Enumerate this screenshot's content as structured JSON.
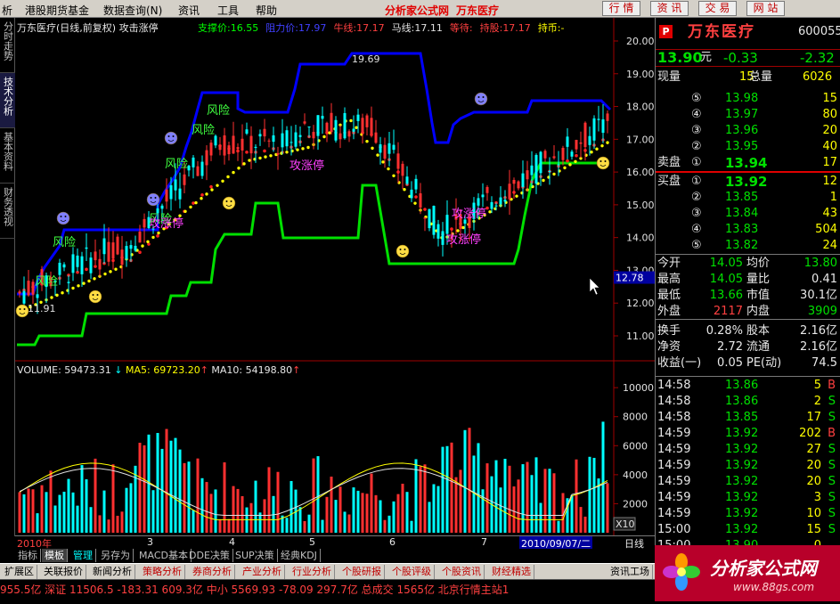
{
  "menu": {
    "items": [
      "析",
      "港股期货基金",
      "数据查询(N)",
      "资讯",
      "工具",
      "帮助"
    ],
    "brand1": "分析家公式网",
    "brand2": "万东医疗",
    "buttons": [
      "行 情",
      "资 讯",
      "交 易",
      "网 站"
    ]
  },
  "left_tabs": [
    "分时走势",
    "技术分析",
    "基本资料",
    "财务透视"
  ],
  "chart": {
    "header_title": "万东医疗(日线,前复权) 攻击涨停",
    "indicators": [
      {
        "label": "支撑价:",
        "value": "16.55",
        "color": "#00ff00"
      },
      {
        "label": "阻力价:",
        "value": "17.97",
        "color": "#4040ff"
      },
      {
        "label": "牛线:",
        "value": "17.17",
        "color": "#ff4040"
      },
      {
        "label": "马线:",
        "value": "17.11",
        "color": "#e0e0e0"
      },
      {
        "label": "等待:",
        "value": "",
        "color": "#ff4040"
      },
      {
        "label": "持股:",
        "value": "17.17",
        "color": "#ff4040"
      },
      {
        "label": "持币:",
        "value": "-",
        "color": "#ffff00"
      }
    ],
    "price_axis": [
      "20.00",
      "19.00",
      "18.00",
      "17.00",
      "16.00",
      "15.00",
      "14.00",
      "13.00",
      "12.00",
      "11.00"
    ],
    "current_price_tag": "12.78",
    "high_label": "19.69",
    "low_label": "11.91",
    "annotations": [
      "风险",
      "风险",
      "风险",
      "风险",
      "风险",
      "风险",
      "攻涨停",
      "攻涨停",
      "攻涨停",
      "攻涨停"
    ],
    "volume_header": {
      "volume": "VOLUME: 59473.31",
      "ma5": "MA5: 69723.20",
      "ma10": "MA10: 54198.80"
    },
    "volume_axis": [
      "10000",
      "8000",
      "6000",
      "4000",
      "2000"
    ],
    "volume_unit": "X10",
    "time_axis": {
      "year": "2010年",
      "months": [
        "3",
        "4",
        "5",
        "6",
        "7",
        "8"
      ],
      "cursor_date": "2010/09/07/二",
      "period": "日线"
    },
    "colors": {
      "resistance": "#0000ff",
      "support": "#00e000",
      "up": "#ff3030",
      "down": "#00ffff",
      "dots": "#ffff00",
      "bull": "#ff2020"
    }
  },
  "bottom_tabs": [
    "指标",
    "模板",
    "管理",
    "另存为",
    "MACD基本",
    "DDE决策",
    "SUP决策",
    "经典KDJ"
  ],
  "tabs2": [
    "扩展区",
    "关联报价",
    "新闻分析",
    "策略分析",
    "券商分析",
    "产业分析",
    "行业分析",
    "个股研报",
    "个股评级",
    "个股资讯",
    "财经精选",
    "资讯工场"
  ],
  "ticker": "955.5亿 深证 11506.5 -183.31 609.3亿 中小 5569.93 -78.09 297.7亿 总成交 1565亿 北京行情主站1",
  "quote": {
    "flag": "P",
    "name": "万东医疗",
    "code": "600055",
    "price": "13.90",
    "unit": "元",
    "change": "-0.33",
    "change_pct": "-2.32",
    "xianliang_label": "现量",
    "xianliang": "15",
    "zongliang_label": "总量",
    "zongliang": "6026",
    "sell_label": "卖盘",
    "buy_label": "买盘",
    "asks": [
      {
        "lvl": "⑤",
        "price": "13.98",
        "vol": "15"
      },
      {
        "lvl": "④",
        "price": "13.97",
        "vol": "80"
      },
      {
        "lvl": "③",
        "price": "13.96",
        "vol": "20"
      },
      {
        "lvl": "②",
        "price": "13.95",
        "vol": "40"
      },
      {
        "lvl": "①",
        "price": "13.94",
        "vol": "17"
      }
    ],
    "bids": [
      {
        "lvl": "①",
        "price": "13.92",
        "vol": "12"
      },
      {
        "lvl": "②",
        "price": "13.85",
        "vol": "1"
      },
      {
        "lvl": "③",
        "price": "13.84",
        "vol": "43"
      },
      {
        "lvl": "④",
        "price": "13.83",
        "vol": "504"
      },
      {
        "lvl": "⑤",
        "price": "13.82",
        "vol": "24"
      }
    ],
    "stats": [
      {
        "l1": "今开",
        "v1": "14.05",
        "c1": "grn",
        "l2": "均价",
        "v2": "13.80",
        "c2": "grn"
      },
      {
        "l1": "最高",
        "v1": "14.05",
        "c1": "grn",
        "l2": "量比",
        "v2": "0.41",
        "c2": "wht"
      },
      {
        "l1": "最低",
        "v1": "13.66",
        "c1": "grn",
        "l2": "市值",
        "v2": "30.1亿",
        "c2": "wht"
      },
      {
        "l1": "外盘",
        "v1": "2117",
        "c1": "red",
        "l2": "内盘",
        "v2": "3909",
        "c2": "grn"
      },
      {
        "l1": "换手",
        "v1": "0.28%",
        "c1": "wht",
        "l2": "股本",
        "v2": "2.16亿",
        "c2": "wht"
      },
      {
        "l1": "净资",
        "v1": "2.72",
        "c1": "wht",
        "l2": "流通",
        "v2": "2.16亿",
        "c2": "wht"
      },
      {
        "l1": "收益(一)",
        "v1": "0.05",
        "c1": "wht",
        "l2": "PE(动)",
        "v2": "74.5",
        "c2": "wht"
      }
    ],
    "ticks": [
      {
        "t": "14:58",
        "p": "13.86",
        "v": "5",
        "s": "B"
      },
      {
        "t": "14:58",
        "p": "13.86",
        "v": "2",
        "s": "S"
      },
      {
        "t": "14:58",
        "p": "13.85",
        "v": "17",
        "s": "S"
      },
      {
        "t": "14:59",
        "p": "13.92",
        "v": "202",
        "s": "B"
      },
      {
        "t": "14:59",
        "p": "13.92",
        "v": "27",
        "s": "S"
      },
      {
        "t": "14:59",
        "p": "13.92",
        "v": "20",
        "s": "S"
      },
      {
        "t": "14:59",
        "p": "13.92",
        "v": "20",
        "s": "S"
      },
      {
        "t": "14:59",
        "p": "13.92",
        "v": "3",
        "s": "S"
      },
      {
        "t": "14:59",
        "p": "13.92",
        "v": "10",
        "s": "S"
      },
      {
        "t": "15:00",
        "p": "13.92",
        "v": "15",
        "s": "S"
      },
      {
        "t": "15:00",
        "p": "13.90",
        "v": "0",
        "s": ""
      }
    ]
  },
  "logo": {
    "text": "分析家公式网",
    "url": "www.88gs.com"
  }
}
